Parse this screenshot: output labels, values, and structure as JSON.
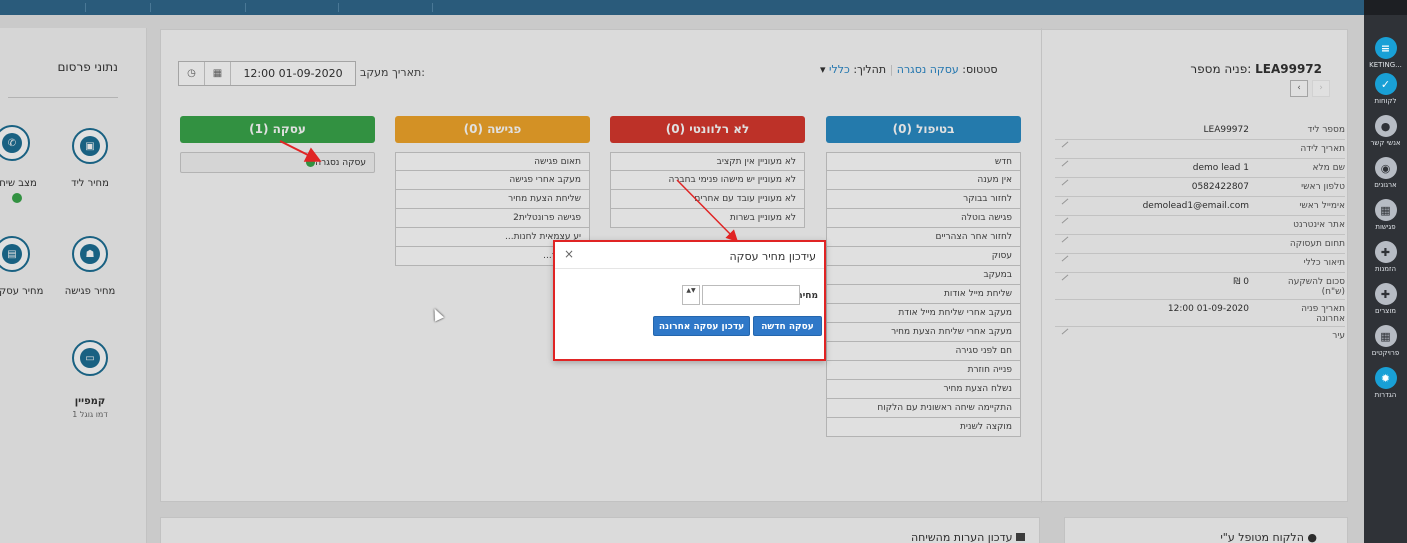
{
  "colors": {
    "topbar": "#2a5b7b",
    "sidebar": "#2f3237",
    "accent": "#19a0d6",
    "green": "#3aa64a",
    "orange": "#f1a52b",
    "red": "#d8382e",
    "blue": "#2a8bc4",
    "modal_border": "#e02424"
  },
  "sidebar": {
    "items": [
      {
        "icon": "menu-icon",
        "label": "KETING..."
      },
      {
        "icon": "check-circle-icon",
        "label": "לקוחות"
      },
      {
        "icon": "user-icon",
        "label": "אנשי קשר"
      },
      {
        "icon": "users-icon",
        "label": "ארגונים"
      },
      {
        "icon": "calendar-icon",
        "label": "פגישות"
      },
      {
        "icon": "puzzle-icon",
        "label": "הזמנות"
      },
      {
        "icon": "puzzle-icon",
        "label": "מוצרים"
      },
      {
        "icon": "grid-icon",
        "label": "פרויקטים"
      },
      {
        "icon": "gear-icon",
        "label": "הגדרות"
      }
    ]
  },
  "left_panel": {
    "title": "נתוני פרסום",
    "items": [
      {
        "label": "מחיר ליד",
        "icon": "briefcase-icon"
      },
      {
        "label": "מצב שיח",
        "icon": "phone-icon"
      },
      {
        "label": "מחיר פגישה",
        "icon": "people-icon"
      },
      {
        "label": "מחיר עסקה",
        "icon": "document-icon"
      },
      {
        "label": "קמפיין",
        "sub": "דמו גוגל 1",
        "icon": "monitor-icon"
      }
    ]
  },
  "lead": {
    "title_label": "פניה מספר:",
    "title_value": "LEA99972",
    "fields": [
      {
        "label": "מספר ליד",
        "value": "LEA99972"
      },
      {
        "label": "תאריך לידה",
        "value": ""
      },
      {
        "label": "שם מלא",
        "value": "demo lead 1"
      },
      {
        "label": "טלפון ראשי",
        "value": "0582422807"
      },
      {
        "label": "אימייל ראשי",
        "value": "demolead1@email.com"
      },
      {
        "label": "אתר אינטרנט",
        "value": ""
      },
      {
        "label": "תחום תעסוקה",
        "value": ""
      },
      {
        "label": "תיאור כללי",
        "value": ""
      },
      {
        "label": "סכום להשקעה (ש\"ח)",
        "value": "₪ 0"
      },
      {
        "label": "תאריך פניה אחרונה",
        "value": "12:00 01-09-2020"
      },
      {
        "label": "עיר",
        "value": ""
      }
    ]
  },
  "status": {
    "status_label": "סטטוס:",
    "status_value": "עסקה נסגרה",
    "process_label": "תהליך:",
    "process_value": "כללי"
  },
  "tracking": {
    "label": "תאריך מעקב:",
    "value": "12:00 01-09-2020"
  },
  "columns": {
    "handling": {
      "title": "בטיפול (0)",
      "items": [
        "חדש",
        "אין מענה",
        "לחזור בבוקר",
        "פגישה בוטלה",
        "לחזור אחר הצהריים",
        "עסוק",
        "במעקב",
        "שליחת מייל אודות",
        "מעקב אחרי שליחת מייל אודת",
        "מעקב אחרי שליחת הצעת מחיר",
        "חם לפני סגירה",
        "פנייה חוזרת",
        "נשלח הצעת מחיר",
        "התקיימה שיחה ראשונית עם הלקוח",
        "מוקצה לשנית"
      ]
    },
    "irrelevant": {
      "title": "לא רלוונטי (0)",
      "items": [
        "לא מעוניין אין תקציב",
        "לא מעוניין יש מישהו פנימי בחברה",
        "לא מעוניין עובד עם אחרים",
        "לא מעוניין בשרות"
      ]
    },
    "meeting": {
      "title": "פגישה (0)",
      "items": [
        "תאום פגישה",
        "מעקב אחרי פגישה",
        "שליחת הצעת מחיר",
        "פגישה פרונטלית2",
        "...יע עצמאית לחנות",
        "...רטי תור"
      ]
    },
    "deal": {
      "title": "עסקה (1)",
      "items": [
        "עסקה נסגרה"
      ]
    }
  },
  "modal": {
    "title": "עידכון מחיר עסקה",
    "close": "×",
    "price_label": "מחיר",
    "price_value": "",
    "stepper": "▲▼",
    "btn_new": "עסקה חדשה",
    "btn_update": "עדכון עסקה אחרונה"
  },
  "bottom": {
    "left_title": "עדכון הערות מהשיחה",
    "right_title": "הלקוח מטופל ע\"י"
  },
  "date_icons": {
    "clock": "◷",
    "calendar": "▦"
  },
  "nav": {
    "prev": "‹",
    "next": "›"
  }
}
